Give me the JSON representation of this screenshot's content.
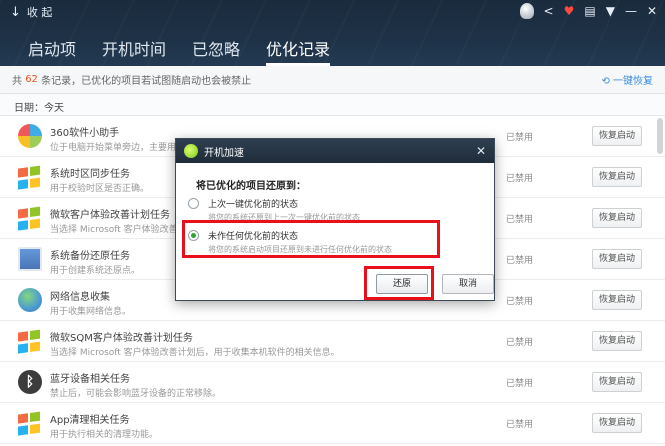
{
  "header": {
    "collapse_label": "收 起",
    "tabs": [
      {
        "label": "启动项"
      },
      {
        "label": "开机时间"
      },
      {
        "label": "已忽略"
      },
      {
        "label": "优化记录"
      }
    ],
    "active_tab": "优化记录",
    "window_icons": {
      "share": "<",
      "gift": "♥",
      "menu": "▤",
      "dropdown": "▼",
      "minimize": "—",
      "close": "✕"
    }
  },
  "infobar": {
    "prefix": "共",
    "count": "62",
    "suffix": "条记录，已优化的项目若试图随启动也会被禁止",
    "oneclick": "一键恢复"
  },
  "date_label": "日期：今天",
  "rows": [
    {
      "name": "360软件小助手",
      "desc": "位于电脑开始菜单旁边，主要用于",
      "status": "已禁用",
      "action": "恢复启动",
      "icon": "360-icon"
    },
    {
      "name": "系统时区同步任务",
      "desc": "用于校验时区是否正确。",
      "status": "已禁用",
      "action": "恢复启动",
      "icon": "windows-icon"
    },
    {
      "name": "微软客户体验改善计划任务",
      "desc": "当选择 Microsoft 客户体验改善",
      "status": "已禁用",
      "action": "恢复启动",
      "icon": "windows-icon"
    },
    {
      "name": "系统备份还原任务",
      "desc": "用于创建系统还原点。",
      "status": "已禁用",
      "action": "恢复启动",
      "icon": "backup-icon"
    },
    {
      "name": "网络信息收集",
      "desc": "用于收集网络信息。",
      "status": "已禁用",
      "action": "恢复启动",
      "icon": "globe-icon"
    },
    {
      "name": "微软SQM客户体验改善计划任务",
      "desc": "当选择 Microsoft 客户体验改善计划后，用于收集本机软件的相关信息。",
      "status": "已禁用",
      "action": "恢复启动",
      "icon": "windows-icon"
    },
    {
      "name": "蓝牙设备相关任务",
      "desc": "禁止后，可能会影响蓝牙设备的正常移除。",
      "status": "已禁用",
      "action": "恢复启动",
      "icon": "bluetooth-icon"
    },
    {
      "name": "App清理相关任务",
      "desc": "用于执行相关的清理功能。",
      "status": "已禁用",
      "action": "恢复启动",
      "icon": "windows-icon"
    }
  ],
  "dialog": {
    "title": "开机加速",
    "question": "将已优化的项目还原到：",
    "options": [
      {
        "label": "上次一键优化前的状态",
        "desc": "将您的系统还原到上一次一键优化前的状态",
        "checked": false
      },
      {
        "label": "未作任何优化前的状态",
        "desc": "将您的系统启动项目还原到未进行任何优化前的状态",
        "checked": true
      }
    ],
    "ok_label": "还原",
    "cancel_label": "取消"
  },
  "colors": {
    "header_bg": "#1e3247",
    "highlight": "#e8101a",
    "count": "#e8541e",
    "link": "#3a8ed8"
  }
}
